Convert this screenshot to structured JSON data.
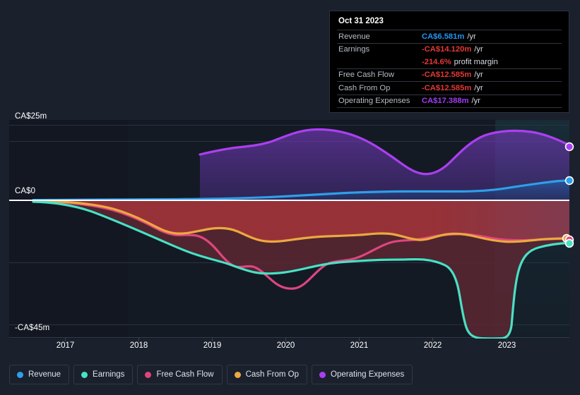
{
  "axis": {
    "y_top_label": "CA$25m",
    "y_zero_label": "CA$0",
    "y_bottom_label": "-CA$45m",
    "x_ticks": [
      "2017",
      "2018",
      "2019",
      "2020",
      "2021",
      "2022",
      "2023"
    ]
  },
  "tooltip": {
    "title": "Oct 31 2023",
    "rows": [
      {
        "label": "Revenue",
        "value": "CA$6.581m",
        "unit": "/yr",
        "color": "#2196f3"
      },
      {
        "label": "Earnings",
        "value": "-CA$14.120m",
        "unit": "/yr",
        "color": "#e53935"
      },
      {
        "label": "",
        "value": "-214.6%",
        "sub": "profit margin",
        "color": "#e53935"
      },
      {
        "label": "Free Cash Flow",
        "value": "-CA$12.585m",
        "unit": "/yr",
        "color": "#e53935"
      },
      {
        "label": "Cash From Op",
        "value": "-CA$12.585m",
        "unit": "/yr",
        "color": "#e53935"
      },
      {
        "label": "Operating Expenses",
        "value": "CA$17.388m",
        "unit": "/yr",
        "color": "#a23cf5"
      }
    ]
  },
  "legend": {
    "items": [
      {
        "label": "Revenue",
        "color": "#2e9fe8"
      },
      {
        "label": "Earnings",
        "color": "#4ae0c4"
      },
      {
        "label": "Free Cash Flow",
        "color": "#e0447f"
      },
      {
        "label": "Cash From Op",
        "color": "#eba93f"
      },
      {
        "label": "Operating Expenses",
        "color": "#ab3ff0"
      }
    ]
  },
  "colors": {
    "background": "#1a202c",
    "revenue": "#2e9fe8",
    "earnings": "#4ae0c4",
    "free_cash_flow": "#e0447f",
    "cash_from_op": "#eba93f",
    "operating_expenses": "#ab3ff0",
    "zero_line": "#ffffff",
    "grid": "#2a3140",
    "negative_fill": "#a8353a"
  },
  "chart_data": {
    "type": "area",
    "title": "",
    "xlabel": "",
    "ylabel": "",
    "currency": "CA$",
    "units": "millions per year",
    "ylim": [
      -45,
      25
    ],
    "xlim": [
      "2016.6",
      "2023.9"
    ],
    "grid": true,
    "legend_position": "bottom-left",
    "annotations": [
      "Oct 31 2023 tooltip showing latest values"
    ],
    "x": [
      2016.6,
      2017.0,
      2017.5,
      2018.0,
      2018.5,
      2018.75,
      2019.0,
      2019.25,
      2019.5,
      2019.75,
      2020.0,
      2020.25,
      2020.5,
      2020.75,
      2021.0,
      2021.25,
      2021.5,
      2021.75,
      2022.0,
      2022.2,
      2022.4,
      2022.6,
      2022.8,
      2023.0,
      2023.25,
      2023.5,
      2023.83
    ],
    "series": [
      {
        "name": "Revenue",
        "color": "#2e9fe8",
        "values": [
          0.1,
          0.1,
          0.15,
          0.2,
          0.25,
          0.3,
          0.4,
          0.6,
          0.9,
          1.2,
          1.6,
          1.9,
          2.1,
          2.3,
          2.6,
          2.9,
          3.2,
          3.4,
          3.5,
          3.5,
          3.5,
          3.6,
          3.8,
          4.2,
          5.0,
          5.8,
          6.581
        ],
        "latest": 6.581
      },
      {
        "name": "Earnings",
        "color": "#4ae0c4",
        "values": [
          -0.7,
          -2.6,
          -5.0,
          -7.4,
          -9.5,
          -10.3,
          -11.5,
          -14.0,
          -16.0,
          -17.5,
          -19.0,
          -20.5,
          -21.5,
          -22.5,
          -22.3,
          -20.0,
          -19.6,
          -20.0,
          -20.0,
          -27.0,
          -40.0,
          -43.5,
          -44.0,
          -44.0,
          -43.0,
          -20.0,
          -14.12
        ],
        "latest": -14.12
      },
      {
        "name": "Free Cash Flow",
        "color": "#e0447f",
        "values": [
          -0.6,
          -2.3,
          -4.3,
          -6.4,
          -8.2,
          -9.0,
          -10.2,
          -14.5,
          -18.0,
          -19.5,
          -22.5,
          -23.0,
          -21.0,
          -19.0,
          -17.0,
          -15.5,
          -14.5,
          -13.5,
          -12.8,
          -12.6,
          -12.6,
          -12.6,
          -12.6,
          -12.6,
          -12.6,
          -12.6,
          -12.585
        ],
        "latest": -12.585
      },
      {
        "name": "Cash From Op",
        "color": "#eba93f",
        "values": [
          -0.6,
          -2.3,
          -4.3,
          -6.4,
          -8.2,
          -8.8,
          -9.6,
          -11.0,
          -12.5,
          -13.3,
          -14.6,
          -14.8,
          -14.0,
          -13.6,
          -13.3,
          -13.0,
          -12.6,
          -11.4,
          -11.2,
          -11.3,
          -11.6,
          -12.0,
          -12.4,
          -13.2,
          -13.0,
          -12.8,
          -12.585
        ],
        "latest": -12.585
      },
      {
        "name": "Operating Expenses",
        "color": "#ab3ff0",
        "start_x": 2018.7,
        "values": [
          null,
          null,
          null,
          null,
          null,
          14.8,
          15.3,
          16.0,
          16.3,
          17.8,
          19.8,
          21.2,
          21.5,
          21.0,
          19.8,
          18.6,
          17.5,
          16.0,
          15.3,
          15.6,
          16.8,
          18.8,
          20.5,
          21.3,
          21.6,
          21.0,
          17.388
        ],
        "latest": 17.388
      }
    ]
  }
}
